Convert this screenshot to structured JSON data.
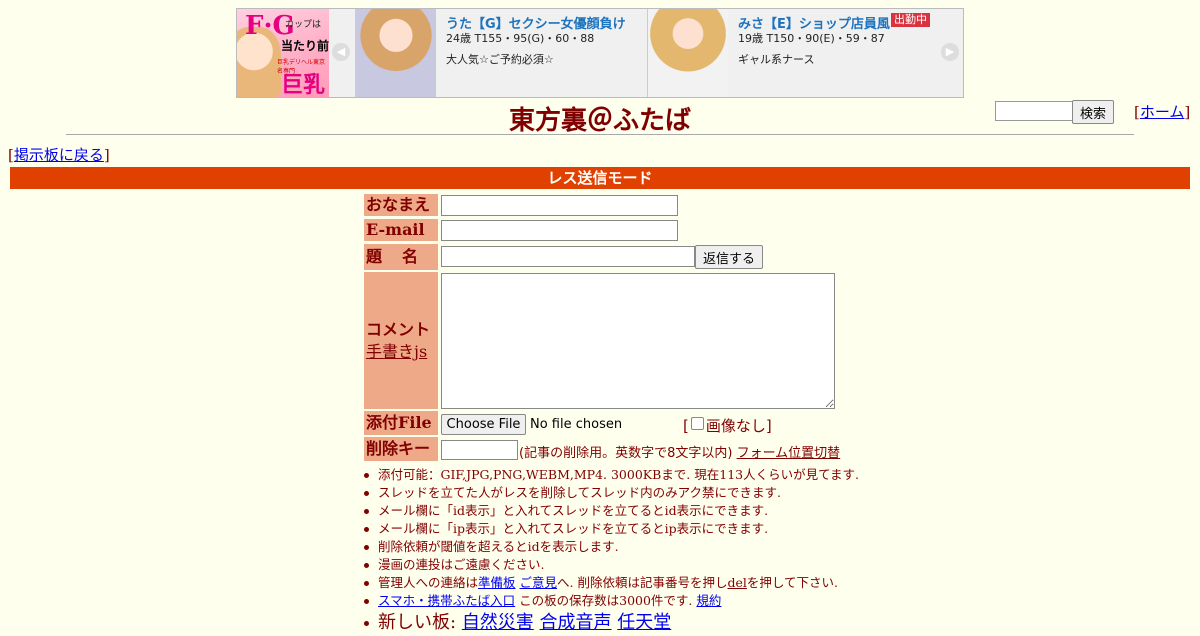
{
  "banner": {
    "logo": {
      "big": "F·G",
      "sub": "カップは",
      "mid": "当たり前",
      "tiny": "巨乳デリヘル東京名専門",
      "cap": "巨乳"
    },
    "cards": [
      {
        "name": "うた【G】セクシー女優顔負け",
        "spec": "24歳 T155・95(G)・60・88",
        "catch": "大人気☆ご予約必須☆",
        "badge": ""
      },
      {
        "name": "みさ【E】ショップ店員風",
        "spec": "19歳 T150・90(E)・59・87",
        "catch": "ギャル系ナース",
        "badge": "出勤中"
      }
    ]
  },
  "header": {
    "title": "東方裏＠ふたば",
    "search_button": "検索",
    "home_link": "ホーム",
    "back_link": "掲示板に戻る"
  },
  "mode_bar": "レス送信モード",
  "form": {
    "name_label": "おなまえ",
    "email_label": "E-mail",
    "subject_label": "題　名",
    "submit_button": "返信する",
    "comment_label": "コメント",
    "tegaki_link": "手書きjs",
    "file_label": "添付File",
    "file_button": "Choose File",
    "file_status": "No file chosen",
    "no_image": "画像なし",
    "delete_label": "削除キー",
    "delete_note": "(記事の削除用。英数字で8文字以内)",
    "form_toggle": "フォーム位置切替"
  },
  "rules": {
    "r1": "添付可能：GIF,JPG,PNG,WEBM,MP4. 3000KBまで. 現在113人くらいが見てます.",
    "r2": "スレッドを立てた人がレスを削除してスレッド内のみアク禁にできます.",
    "r3": "メール欄に「id表示」と入れてスレッドを立てるとid表示にできます.",
    "r4": "メール欄に「ip表示」と入れてスレッドを立てるとip表示にできます.",
    "r5": "削除依頼が閾値を超えるとidを表示します.",
    "r6": "漫画の連投はご遠慮ください.",
    "r7_pre": "管理人への連絡は",
    "r7_link1": "準備板",
    "r7_link2": "ご意見",
    "r7_mid": "へ. 削除依頼は記事番号を押し",
    "r7_del": "del",
    "r7_post": "を押して下さい.",
    "r8_link": "スマホ・携帯ふたば入口",
    "r8_mid": "この板の保存数は3000件です.",
    "r8_rule": "規約",
    "r9_pre": "新しい板:",
    "r9_boards": [
      "自然災害",
      "合成音声",
      "任天堂"
    ]
  }
}
